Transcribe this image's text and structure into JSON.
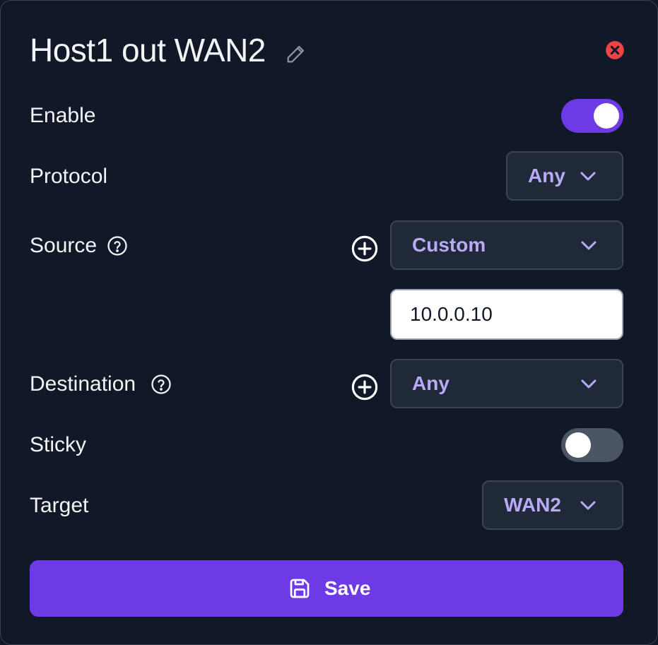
{
  "dialog": {
    "title": "Host1 out WAN2"
  },
  "fields": {
    "enable": {
      "label": "Enable",
      "on": true
    },
    "protocol": {
      "label": "Protocol",
      "value": "Any"
    },
    "source": {
      "label": "Source",
      "value": "Custom",
      "address": "10.0.0.10"
    },
    "destination": {
      "label": "Destination",
      "value": "Any"
    },
    "sticky": {
      "label": "Sticky",
      "on": false
    },
    "target": {
      "label": "Target",
      "value": "WAN2"
    }
  },
  "actions": {
    "save_label": "Save"
  },
  "icons": {
    "edit": "pencil-icon",
    "close": "close-circle-icon",
    "help": "question-circle-icon",
    "add": "plus-circle-icon",
    "chevron": "chevron-down-icon",
    "save": "floppy-disk-icon"
  },
  "colors": {
    "background": "#111827",
    "accent": "#6d3ae6",
    "select_text": "#b9a9f7",
    "close": "#ef4444",
    "toggle_off": "#4b5563"
  }
}
